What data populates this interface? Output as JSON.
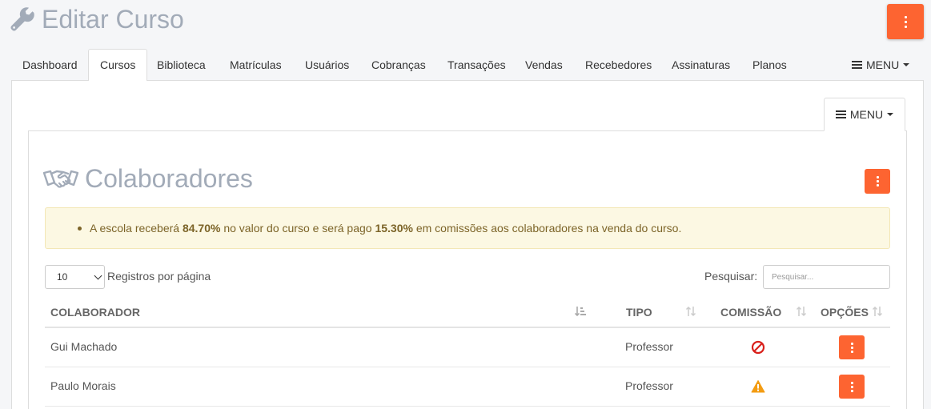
{
  "page": {
    "title": "Editar Curso"
  },
  "nav": {
    "tabs": [
      {
        "label": "Dashboard"
      },
      {
        "label": "Cursos",
        "active": true
      },
      {
        "label": "Biblioteca"
      },
      {
        "label": "Matrículas"
      },
      {
        "label": "Usuários"
      },
      {
        "label": "Cobranças"
      },
      {
        "label": "Transações"
      },
      {
        "label": "Vendas"
      },
      {
        "label": "Recebedores"
      },
      {
        "label": "Assinaturas"
      },
      {
        "label": "Planos"
      }
    ],
    "menu_label": "MENU"
  },
  "inner_menu": {
    "label": "MENU"
  },
  "section": {
    "title": "Colaboradores"
  },
  "alert": {
    "prefix": "A escola receberá ",
    "school_percent": "84.70%",
    "middle": " no valor do curso e será pago ",
    "commission_percent": "15.30%",
    "suffix": " em comissões aos colaboradores na venda do curso."
  },
  "table_controls": {
    "length_value": "10",
    "length_label": "Registros por página",
    "search_label": "Pesquisar:",
    "search_placeholder": "Pesquisar..."
  },
  "table": {
    "headers": {
      "colaborador": "COLABORADOR",
      "tipo": "TIPO",
      "comissao": "COMISSÃO",
      "opcoes": "OPÇÕES"
    },
    "rows": [
      {
        "colaborador": "Gui Machado",
        "tipo": "Professor",
        "comissao_icon": "ban-icon"
      },
      {
        "colaborador": "Paulo Morais",
        "tipo": "Professor",
        "comissao_icon": "warning-icon"
      }
    ]
  },
  "colors": {
    "accent": "#fd6431",
    "title_gray": "#a2abb8",
    "alert_bg": "#fcf8e3",
    "ban_red": "#d9211c",
    "warning_amber": "#f39c12"
  }
}
